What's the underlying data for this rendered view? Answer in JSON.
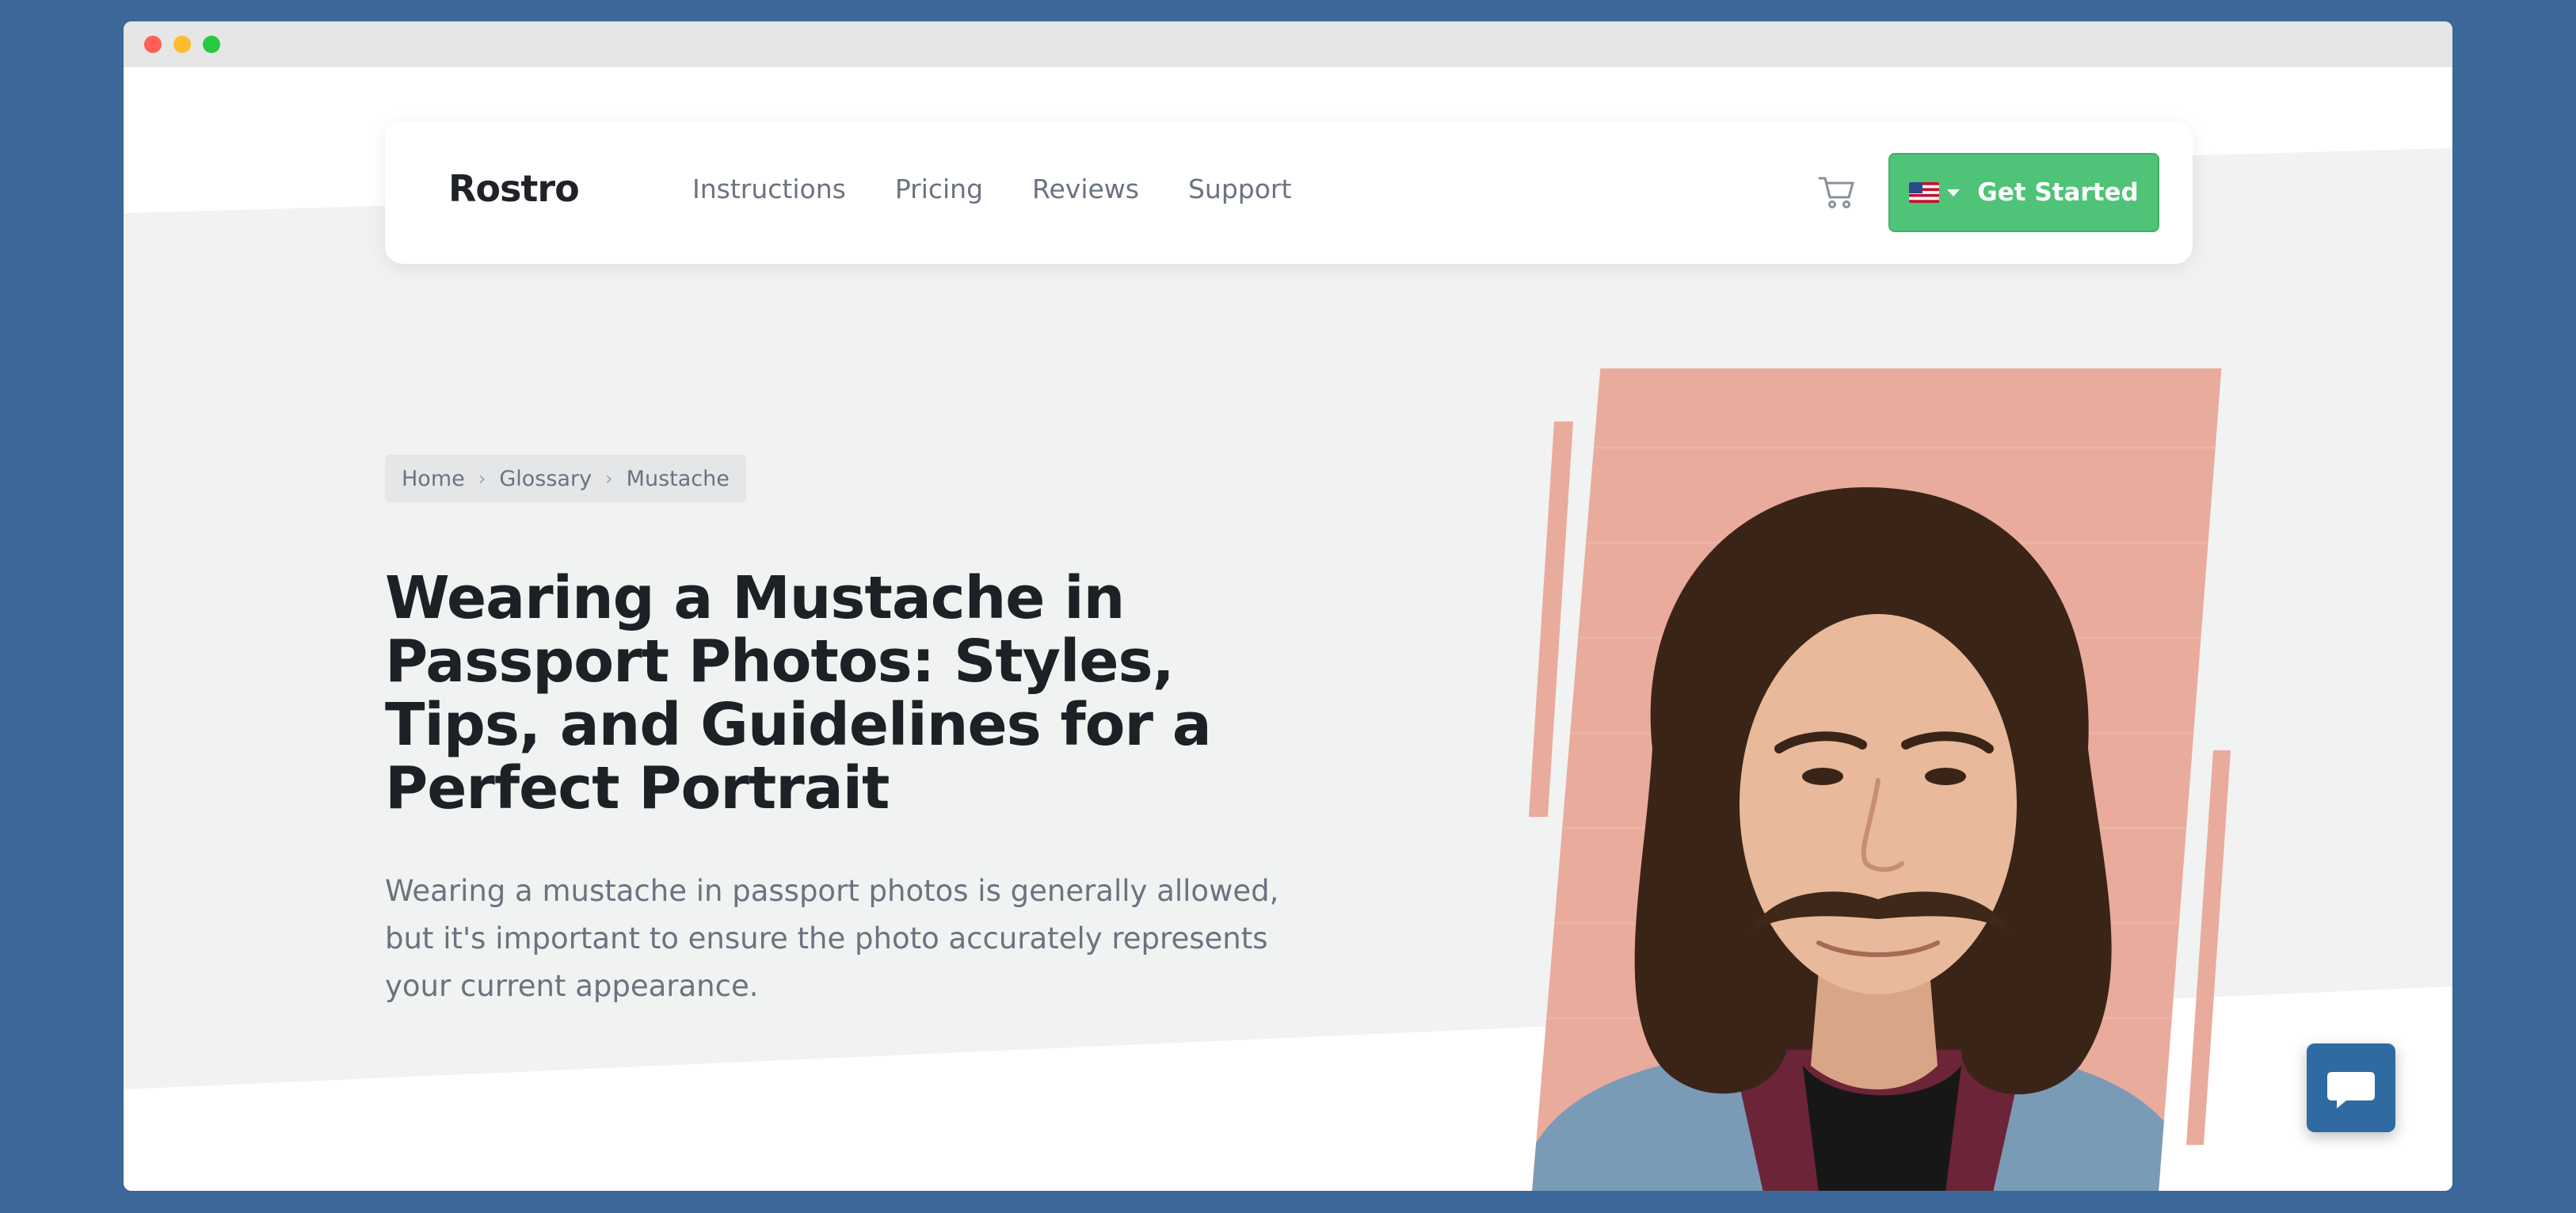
{
  "brand": {
    "name": "Rostro"
  },
  "nav": {
    "links": [
      "Instructions",
      "Pricing",
      "Reviews",
      "Support"
    ],
    "cta_label": "Get Started",
    "language_flag": "us-flag-icon"
  },
  "breadcrumb": [
    "Home",
    "Glossary",
    "Mustache"
  ],
  "hero": {
    "title": "Wearing a Mustache in Passport Photos: Styles, Tips, and Guidelines for a Perfect Portrait",
    "subtitle": "Wearing a mustache in passport photos is generally allowed, but it's important to ensure the photo accurately represents your current appearance."
  },
  "colors": {
    "accent": "#4fc377",
    "background": "#3b6898",
    "hero_bg": "#f1f2f2",
    "photo_pink": "#e9ab9c",
    "chat_button": "#2f6aa3"
  },
  "icons": {
    "cart": "cart-icon",
    "chat": "chat-bubble-icon"
  }
}
